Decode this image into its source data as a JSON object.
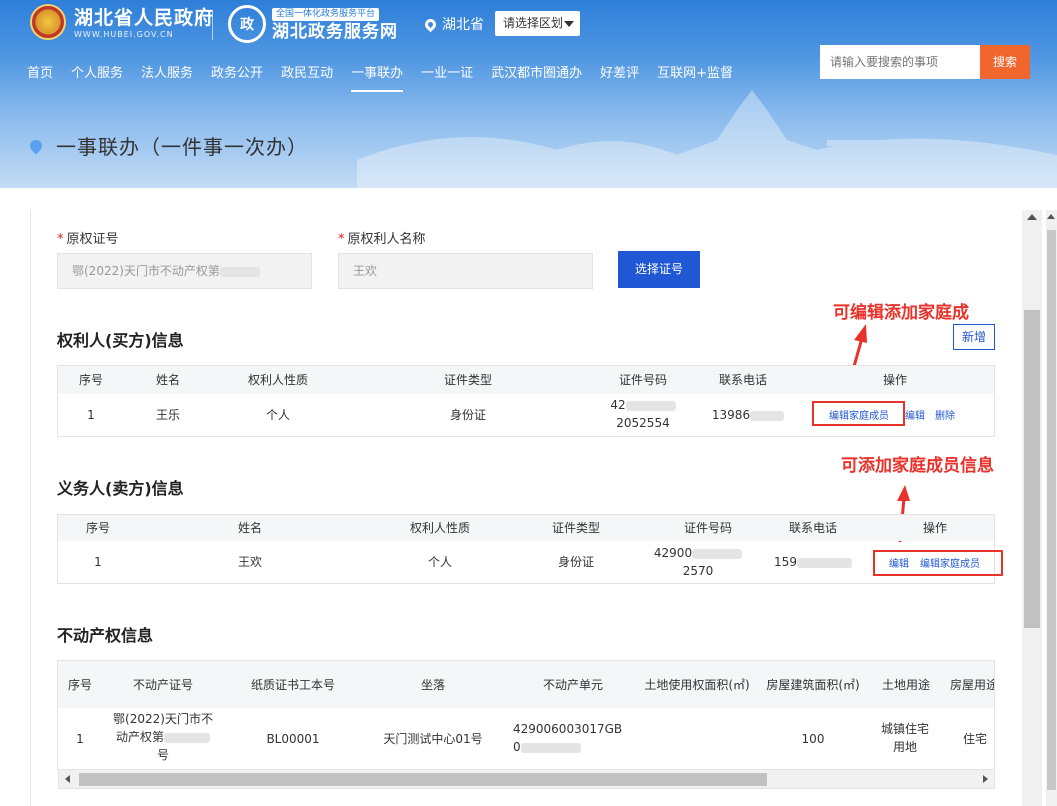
{
  "header": {
    "gov_name": "湖北省人民政府",
    "gov_url": "WWW.HUBEI.GOV.CN",
    "platform_tag": "全国一体化政务服务平台",
    "platform_name": "湖北政务服务网",
    "province": "湖北省",
    "region_select": "请选择区划",
    "search_placeholder": "请输入要搜索的事项",
    "search_button": "搜索",
    "nav": [
      "首页",
      "个人服务",
      "法人服务",
      "政务公开",
      "政民互动",
      "一事联办",
      "一业一证",
      "武汉都市圈通办",
      "好差评",
      "互联网+监督"
    ],
    "active_nav": "一事联办",
    "page_title": "一事联办（一件事一次办）"
  },
  "form": {
    "cert_label": "原权证号",
    "cert_value": "鄂(2022)天门市不动产权第",
    "owner_label": "原权利人名称",
    "owner_value": "王欢",
    "select_button": "选择证号"
  },
  "buyer": {
    "title": "权利人(买方)信息",
    "add_button": "新增",
    "headers": [
      "序号",
      "姓名",
      "权利人性质",
      "证件类型",
      "证件号码",
      "联系电话",
      "操作"
    ],
    "row": {
      "index": "1",
      "name": "王乐",
      "nature": "个人",
      "id_type": "身份证",
      "id_line1": "42",
      "id_line2": "2052554",
      "phone": "13986",
      "action_family": "编辑家庭成员",
      "action_edit": "编辑",
      "action_delete": "删除"
    },
    "annotation": "可编辑添加家庭成"
  },
  "seller": {
    "title": "义务人(卖方)信息",
    "headers": [
      "序号",
      "姓名",
      "权利人性质",
      "证件类型",
      "证件号码",
      "联系电话",
      "操作"
    ],
    "row": {
      "index": "1",
      "name": "王欢",
      "nature": "个人",
      "id_type": "身份证",
      "id_line1": "42900",
      "id_line2": "2570",
      "phone": "159",
      "action_edit": "编辑",
      "action_family": "编辑家庭成员"
    },
    "annotation": "可添加家庭成员信息"
  },
  "property": {
    "title": "不动产权信息",
    "headers": [
      "序号",
      "不动产证号",
      "纸质证书工本号",
      "坐落",
      "不动产单元",
      "土地使用权面积(㎡)",
      "房屋建筑面积(㎡)",
      "土地用途",
      "房屋用途"
    ],
    "row": {
      "index": "1",
      "cert_line1": "鄂(2022)天门市不",
      "cert_line2": "动产权第",
      "cert_line3": "号",
      "paper_no": "BL00001",
      "location": "天门测试中心01号",
      "unit_line1": "429006003017GB",
      "unit_line2": "0",
      "land_area": "",
      "building_area": "100",
      "land_use_line1": "城镇住宅",
      "land_use_line2": "用地",
      "house_use": "住宅"
    }
  },
  "colors": {
    "primary": "#2057d4",
    "accent": "#f0662d",
    "annotation": "#e8322a",
    "required": "#e02020"
  }
}
